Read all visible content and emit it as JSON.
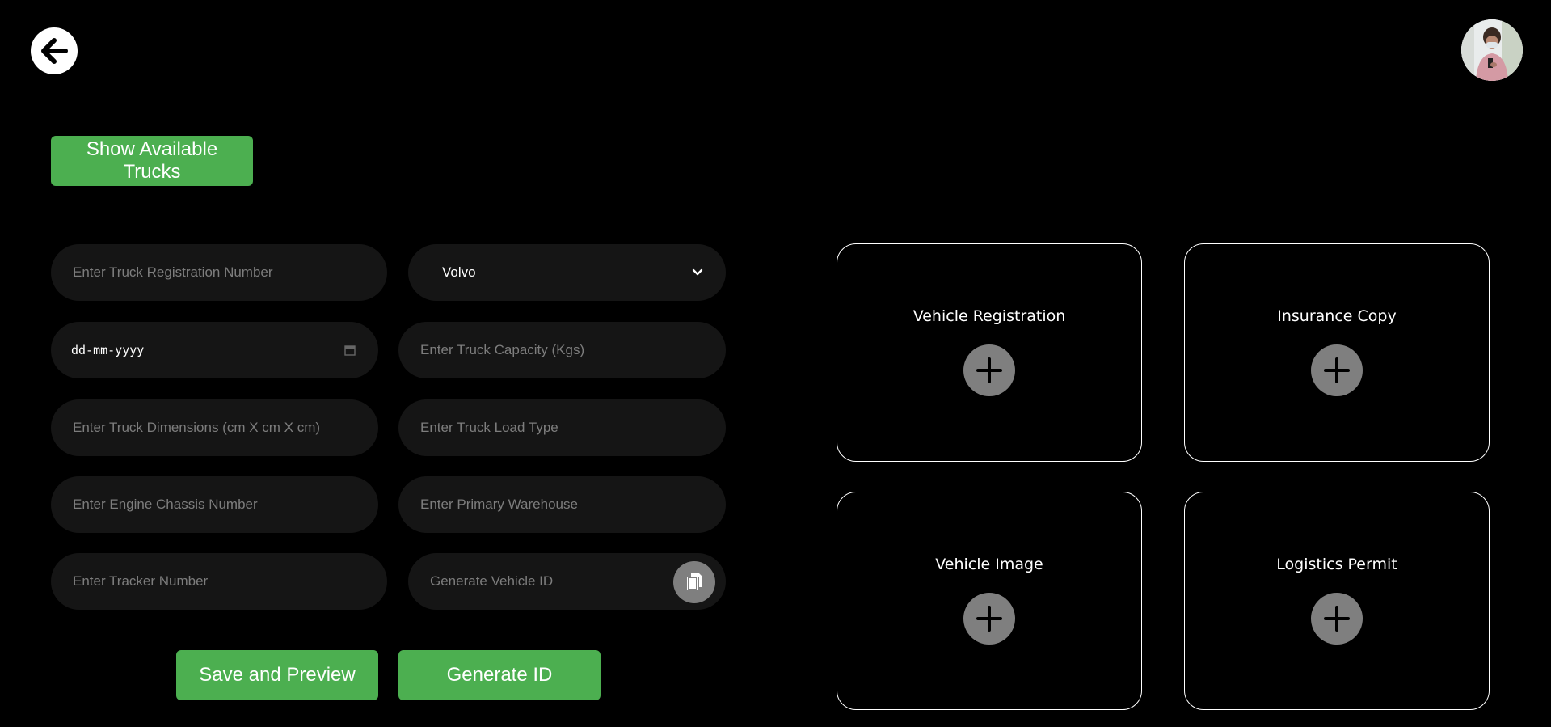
{
  "header": {
    "back_icon": "arrow-left-icon",
    "avatar_icon": "user-avatar"
  },
  "actions": {
    "show_trucks_label": "Show Available Trucks",
    "save_preview_label": "Save and Preview",
    "generate_id_label": "Generate ID"
  },
  "form": {
    "registration_placeholder": "Enter Truck Registration Number",
    "make_selected": "Volvo",
    "date_value": "dd-mm-yyyy",
    "capacity_placeholder": "Enter Truck Capacity (Kgs)",
    "dimensions_placeholder": "Enter Truck Dimensions (cm X cm X cm)",
    "load_type_placeholder": "Enter Truck Load Type",
    "chassis_placeholder": "Enter Engine Chassis Number",
    "warehouse_placeholder": "Enter Primary Warehouse",
    "tracker_placeholder": "Enter Tracker Number",
    "vehicle_id_placeholder": "Generate Vehicle ID"
  },
  "uploads": [
    {
      "title": "Vehicle Registration"
    },
    {
      "title": "Insurance Copy"
    },
    {
      "title": "Vehicle Image"
    },
    {
      "title": "Logistics Permit"
    }
  ],
  "colors": {
    "background": "#000000",
    "accent_green": "#4caf50",
    "field_bg": "#151515",
    "icon_grey": "#7f7f7f"
  }
}
